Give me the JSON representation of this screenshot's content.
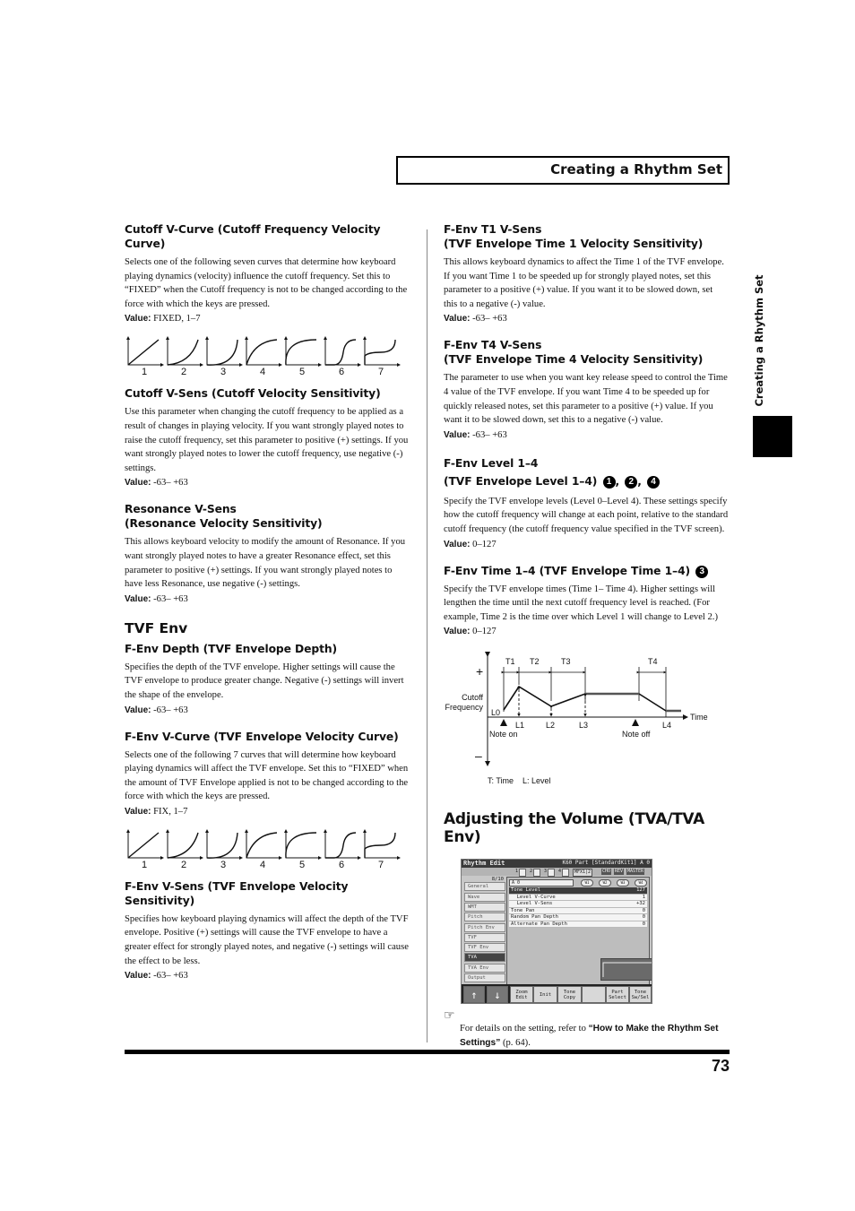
{
  "running_header": "Creating a Rhythm Set",
  "side_tab": "Creating a Rhythm Set",
  "page_number": "73",
  "left_column": {
    "cutoff_v_curve": {
      "heading": "Cutoff V-Curve (Cutoff Frequency Velocity Curve)",
      "body": "Selects one of the following seven curves that determine how keyboard playing dynamics (velocity) influence the cutoff frequency. Set this to “FIXED” when the Cutoff frequency is not to be changed according to the force with which the keys are pressed.",
      "value_label": "Value:",
      "value": "FIXED, 1–7",
      "curve_labels": [
        "1",
        "2",
        "3",
        "4",
        "5",
        "6",
        "7"
      ]
    },
    "cutoff_v_sens": {
      "heading": "Cutoff V-Sens (Cutoff Velocity Sensitivity)",
      "body": "Use this parameter when changing the cutoff frequency to be applied as a result of changes in playing velocity. If you want strongly played notes to raise the cutoff frequency, set this parameter to positive (+) settings. If you want strongly played notes to lower the cutoff frequency, use negative (-) settings.",
      "value_label": "Value:",
      "value": "-63– +63"
    },
    "resonance_v_sens": {
      "heading_line1": "Resonance V-Sens",
      "heading_line2": "(Resonance Velocity Sensitivity)",
      "body": "This allows keyboard velocity to modify the amount of Resonance. If you want strongly played notes to have a greater Resonance effect, set this parameter to positive (+) settings. If you want strongly played notes to have less Resonance, use negative (-) settings.",
      "value_label": "Value:",
      "value": "-63– +63"
    },
    "tvf_env_title": "TVF Env",
    "f_env_depth": {
      "heading": "F-Env Depth (TVF Envelope Depth)",
      "body": "Specifies the depth of the TVF envelope. Higher settings will cause the TVF envelope to produce greater change. Negative (-) settings will invert the shape of the envelope.",
      "value_label": "Value:",
      "value": "-63– +63"
    },
    "f_env_v_curve": {
      "heading": "F-Env V-Curve (TVF Envelope Velocity Curve)",
      "body": "Selects one of the following 7 curves that will determine how keyboard playing dynamics will affect the TVF envelope. Set this to “FIXED” when the amount of TVF Envelope applied is not to be changed according to the force with which the keys are pressed.",
      "value_label": "Value:",
      "value": "FIX, 1–7",
      "curve_labels": [
        "1",
        "2",
        "3",
        "4",
        "5",
        "6",
        "7"
      ]
    },
    "f_env_v_sens": {
      "heading": "F-Env V-Sens (TVF Envelope Velocity Sensitivity)",
      "body": "Specifies how keyboard playing dynamics will affect the depth of the TVF envelope. Positive (+) settings will cause the TVF envelope to have a greater effect for strongly played notes, and negative (-) settings will cause the effect to be less.",
      "value_label": "Value:",
      "value": "-63– +63"
    }
  },
  "right_column": {
    "f_env_t1_v_sens": {
      "heading_line1": "F-Env T1 V-Sens",
      "heading_line2": "(TVF Envelope Time 1 Velocity Sensitivity)",
      "body": "This allows keyboard dynamics to affect the Time 1 of the TVF envelope. If you want Time 1 to be speeded up for strongly played notes, set this parameter to a positive (+) value. If you want it to be slowed down, set this to a negative (-) value.",
      "value_label": "Value:",
      "value": "-63– +63"
    },
    "f_env_t4_v_sens": {
      "heading_line1": "F-Env T4 V-Sens",
      "heading_line2": "(TVF Envelope Time 4 Velocity Sensitivity)",
      "body": "The parameter to use when you want key release speed to control the Time 4 value of the TVF envelope. If you want Time 4 to be speeded up for quickly released notes, set this parameter to a positive (+) value. If you want it to be slowed down, set this to a negative (-) value.",
      "value_label": "Value:",
      "value": "-63– +63"
    },
    "f_env_level": {
      "heading_line1": "F-Env Level 1–4",
      "heading_line2": "(TVF Envelope Level 1–4)",
      "markers": [
        "1",
        "2",
        "4"
      ],
      "body": "Specify the TVF envelope levels (Level 0–Level 4). These settings specify how the cutoff frequency will change at each point, relative to the standard cutoff frequency (the cutoff frequency value specified in the TVF screen).",
      "value_label": "Value:",
      "value": "0–127"
    },
    "f_env_time": {
      "heading": "F-Env Time 1–4 (TVF Envelope Time 1–4)",
      "marker": "3",
      "body": "Specify the TVF envelope times (Time 1– Time 4). Higher settings will lengthen the time until the next cutoff frequency level is reached. (For example, Time 2 is the time over which Level 1 will change to Level 2.)",
      "value_label": "Value:",
      "value": "0–127"
    },
    "envelope_diagram": {
      "plus": "+",
      "minus": "–",
      "y_label_line1": "Cutoff",
      "y_label_line2": "Frequency",
      "x_label": "Time",
      "time_labels": [
        "T1",
        "T2",
        "T3",
        "T4"
      ],
      "level_labels": [
        "L0",
        "L1",
        "L2",
        "L3",
        "L4"
      ],
      "note_on": "Note on",
      "note_off": "Note off",
      "legend": "T: Time    L: Level"
    },
    "tva_title": "Adjusting the Volume (TVA/TVA Env)",
    "lcd": {
      "title": "Rhythm Edit",
      "part_info": "K60 Part  [StandardKit1] A 0",
      "tone_tabs": [
        "1",
        "2",
        "3",
        "4"
      ],
      "fx_labels": [
        "MFX1|2",
        "CHO",
        "REV",
        "MASTER"
      ],
      "page": "8/10",
      "nav_items": [
        "General",
        "Wave",
        "WMT",
        "Pitch",
        "Pitch Env",
        "TVF",
        "TVF Env",
        "TVA",
        "TVA Env",
        "Output"
      ],
      "active_nav": "TVA",
      "key_select": "A 0",
      "wmt_pills": [
        "W1",
        "W2",
        "W3",
        "W4"
      ],
      "params": [
        {
          "name": "Tone Level",
          "value": "127"
        },
        {
          "name": "  Level V-Curve",
          "value": "1"
        },
        {
          "name": "  Level V-Sens",
          "value": "+32"
        },
        {
          "name": "Tone Pan",
          "value": "0"
        },
        {
          "name": "Random Pan Depth",
          "value": "0"
        },
        {
          "name": "Alternate Pan Depth",
          "value": "0"
        }
      ],
      "function_buttons": [
        "↑",
        "↓",
        "Zoom Edit",
        "Init",
        "Tone Copy",
        "",
        "Part Select",
        "Tone Sw/Sel"
      ]
    },
    "reference": {
      "icon": "☞",
      "text_before": "For details on the setting, refer to ",
      "link_text": "“How to Make the Rhythm Set Settings”",
      "text_after": " (p. 64)."
    }
  }
}
